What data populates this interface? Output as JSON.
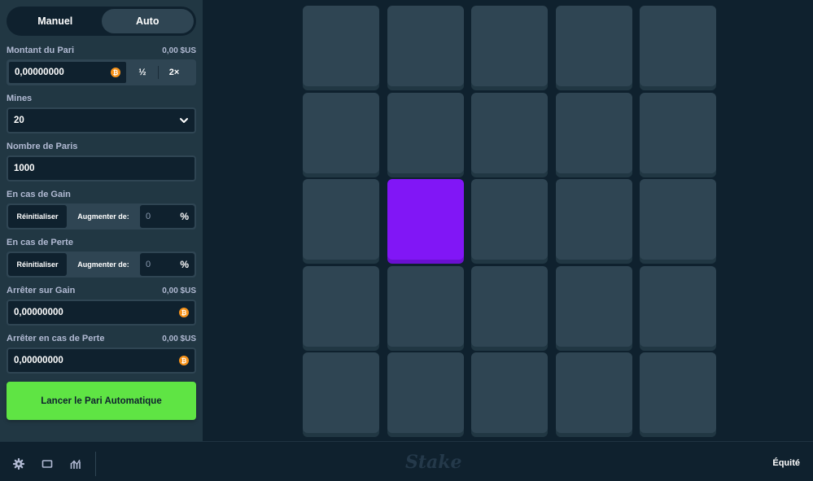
{
  "mode_tabs": {
    "manual": "Manuel",
    "auto": "Auto",
    "active": "Auto"
  },
  "bet_amount": {
    "label": "Montant du Pari",
    "usd": "0,00 $US",
    "value": "0,00000000",
    "currency_icon": "bitcoin-icon",
    "half": "½",
    "double": "2×"
  },
  "mines": {
    "label": "Mines",
    "value": "20"
  },
  "number_of_bets": {
    "label": "Nombre de Paris",
    "value": "1000"
  },
  "on_win": {
    "label": "En cas de Gain",
    "reset": "Réinitialiser",
    "increase_label": "Augmenter de:",
    "value": "0",
    "unit": "%"
  },
  "on_loss": {
    "label": "En cas de Perte",
    "reset": "Réinitialiser",
    "increase_label": "Augmenter de:",
    "value": "0",
    "unit": "%"
  },
  "stop_on_profit": {
    "label": "Arrêter sur Gain",
    "usd": "0,00 $US",
    "value": "0,00000000"
  },
  "stop_on_loss": {
    "label": "Arrêter en cas de Perte",
    "usd": "0,00 $US",
    "value": "0,00000000"
  },
  "launch_button": "Lancer le Pari Automatique",
  "grid": {
    "rows": 5,
    "cols": 5,
    "selected_tiles": [
      11
    ]
  },
  "footer": {
    "logo": "Stake",
    "fairness": "Équité"
  },
  "colors": {
    "accent_green": "#5fe444",
    "selected_purple": "#8116f6",
    "tile": "#2f4553",
    "sidebar": "#213743",
    "background": "#0f212e"
  }
}
